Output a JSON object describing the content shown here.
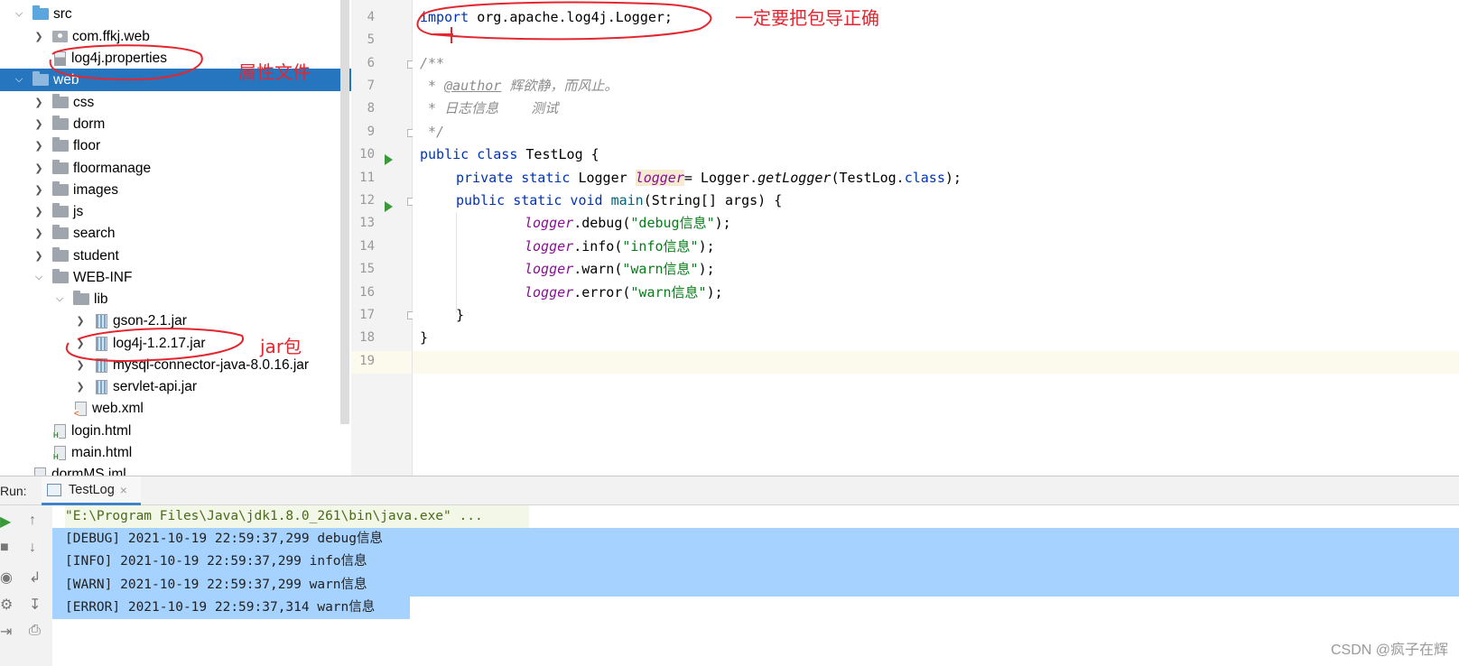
{
  "project_tree": {
    "items": [
      {
        "label": "src",
        "icon": "source-folder-icon",
        "expand": "open"
      },
      {
        "label": "com.ffkj.web",
        "icon": "package-icon",
        "expand": "closed"
      },
      {
        "label": "log4j.properties",
        "icon": "properties-file-icon",
        "expand": "none"
      },
      {
        "label": "web",
        "icon": "web-folder-icon",
        "expand": "open",
        "selected": true
      },
      {
        "label": "css",
        "icon": "folder-icon",
        "expand": "closed"
      },
      {
        "label": "dorm",
        "icon": "folder-icon",
        "expand": "closed"
      },
      {
        "label": "floor",
        "icon": "folder-icon",
        "expand": "closed"
      },
      {
        "label": "floormanage",
        "icon": "folder-icon",
        "expand": "closed"
      },
      {
        "label": "images",
        "icon": "folder-icon",
        "expand": "closed"
      },
      {
        "label": "js",
        "icon": "folder-icon",
        "expand": "closed"
      },
      {
        "label": "search",
        "icon": "folder-icon",
        "expand": "closed"
      },
      {
        "label": "student",
        "icon": "folder-icon",
        "expand": "closed"
      },
      {
        "label": "WEB-INF",
        "icon": "folder-icon",
        "expand": "open"
      },
      {
        "label": "lib",
        "icon": "folder-icon",
        "expand": "open"
      },
      {
        "label": "gson-2.1.jar",
        "icon": "jar-icon",
        "expand": "closed"
      },
      {
        "label": "log4j-1.2.17.jar",
        "icon": "jar-icon",
        "expand": "closed"
      },
      {
        "label": "mysql-connector-java-8.0.16.jar",
        "icon": "jar-icon",
        "expand": "closed"
      },
      {
        "label": "servlet-api.jar",
        "icon": "jar-icon",
        "expand": "closed"
      },
      {
        "label": "web.xml",
        "icon": "xml-file-icon",
        "expand": "none"
      },
      {
        "label": "login.html",
        "icon": "html-file-icon",
        "expand": "none"
      },
      {
        "label": "main.html",
        "icon": "html-file-icon",
        "expand": "none"
      },
      {
        "label": "dormMS.iml",
        "icon": "iml-file-icon",
        "expand": "none"
      }
    ]
  },
  "editor": {
    "line_numbers": [
      "4",
      "5",
      "6",
      "7",
      "8",
      "9",
      "10",
      "11",
      "12",
      "13",
      "14",
      "15",
      "16",
      "17",
      "18",
      "19"
    ],
    "lines": {
      "l4_kw": "import",
      "l4_rest": " org.apache.log4j.Logger;",
      "l6": "/**",
      "l7_prefix": " * ",
      "l7_tag": "@author",
      "l7_text": " 辉欲静，而风止。",
      "l8": " * 日志信息    测试",
      "l9": " */",
      "l10_kw": "public class",
      "l10_rest": " TestLog {",
      "l11_kw": "private static",
      "l11_type": " Logger ",
      "l11_field": "logger",
      "l11_eq": "= Logger.",
      "l11_method": "getLogger",
      "l11_arg": "(TestLog.",
      "l11_class_kw": "class",
      "l11_end": ");",
      "l12_kw": "public static void",
      "l12_method": "main",
      "l12_rest": "(String[] args) {",
      "l13_field": "logger",
      "l13_call": ".debug(",
      "l13_str": "\"debug信息\"",
      "l13_end": ");",
      "l14_field": "logger",
      "l14_call": ".info(",
      "l14_str": "\"info信息\"",
      "l14_end": ");",
      "l15_field": "logger",
      "l15_call": ".warn(",
      "l15_str": "\"warn信息\"",
      "l15_end": ");",
      "l16_field": "logger",
      "l16_call": ".error(",
      "l16_str": "\"warn信息\"",
      "l16_end": ");",
      "l17": "}",
      "l18": "}"
    }
  },
  "run_panel": {
    "label": "Run:",
    "tab_label": "TestLog",
    "tab_close": "×",
    "console_lines": [
      "\"E:\\Program Files\\Java\\jdk1.8.0_261\\bin\\java.exe\" ...",
      "[DEBUG] 2021-10-19 22:59:37,299 debug信息",
      "[INFO] 2021-10-19 22:59:37,299 info信息",
      "[WARN] 2021-10-19 22:59:37,299 warn信息",
      "[ERROR] 2021-10-19 22:59:37,314 warn信息"
    ]
  },
  "annotations": {
    "import_note": "一定要把包导正确",
    "properties_note": "属性文件",
    "jar_note": "jar包"
  },
  "watermark": "CSDN @疯子在辉",
  "colors": {
    "selection": "#2675bf",
    "keyword": "#0033b3",
    "field": "#871094",
    "string": "#067d17",
    "annotation_red": "#e3262f",
    "console_selection": "#a6d2ff"
  }
}
